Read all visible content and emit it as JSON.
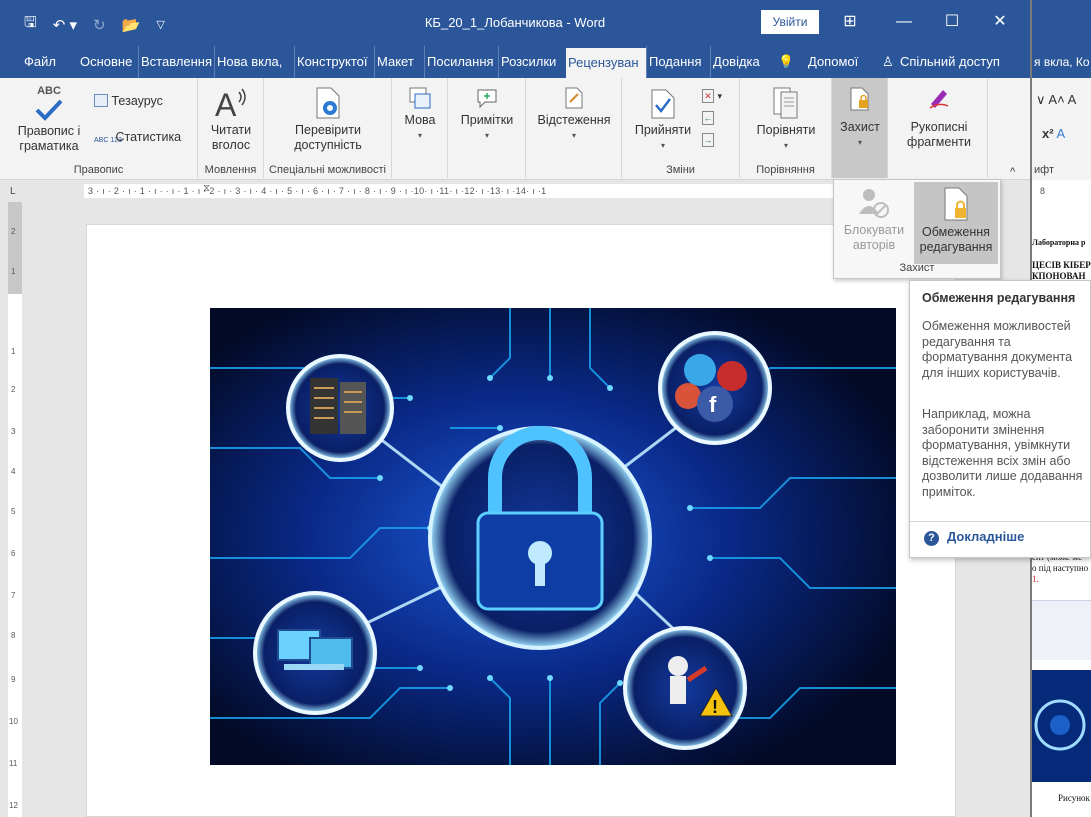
{
  "window": {
    "title": "КБ_20_1_Лобанчикова - Word",
    "login_label": "Увійти",
    "minimize": "—",
    "restore": "☐",
    "close": "✕"
  },
  "tabs": [
    {
      "label": "Файл"
    },
    {
      "label": "Основне"
    },
    {
      "label": "Вставлення"
    },
    {
      "label": "Нова вкла,"
    },
    {
      "label": "Конструктої"
    },
    {
      "label": "Макет"
    },
    {
      "label": "Посилання"
    },
    {
      "label": "Розсилки"
    },
    {
      "label": "Рецензуван"
    },
    {
      "label": "Подання"
    },
    {
      "label": "Довідка"
    },
    {
      "label": "Допомої"
    },
    {
      "label": "Спільний доступ"
    }
  ],
  "ribbon": {
    "proofing": {
      "spelling_top": "ABC",
      "spelling_line1": "Правопис і",
      "spelling_line2": "граматика",
      "thesaurus": "Тезаурус",
      "stats_icon_text": "ABC 123",
      "stats": "Статистика",
      "group": "Правопис"
    },
    "speech": {
      "line1": "Читати",
      "line2": "вголос",
      "group": "Мовлення"
    },
    "access": {
      "line1": "Перевірити",
      "line2": "доступність",
      "group": "Спеціальні можливості"
    },
    "language": {
      "label": "Мова"
    },
    "comments": {
      "label": "Примітки"
    },
    "tracking": {
      "label": "Відстеження"
    },
    "changes": {
      "accept": "Прийняти",
      "group": "Зміни"
    },
    "compare": {
      "label": "Порівняти",
      "group": "Порівняння"
    },
    "protect": {
      "label": "Захист"
    },
    "ink": {
      "line1": "Рукописні",
      "line2": "фрагменти"
    }
  },
  "ruler": {
    "text": "3 · ı · 2 · ı · 1 · ı ·  ·  ı · 1 · ı · 2 · ı · 3 · ı · 4 · ı · 5 · ı · 6 · ı · 7 · ı · 8 · ı · 9 · ı ·10· ı ·11· ı ·12· ı ·13· ı ·14· ı ·1"
  },
  "protect_dropdown": {
    "block_line1": "Блокувати",
    "block_line2": "авторів",
    "restrict_line1": "Обмеження",
    "restrict_line2": "редагування",
    "group": "Захист"
  },
  "tooltip": {
    "title": "Обмеження редагування",
    "p1": "Обмеження можливостей редагування та форматування документа для інших користувачів.",
    "p2": "Наприклад, можна заборонити змінення форматування, увімкнути відстеження всіх змін або дозволити лише додавання приміток.",
    "more": "Докладніше"
  },
  "right_window": {
    "tabs": "я вкла, Ко",
    "font_group": "ифт",
    "ruler_num": "8",
    "line1": "Лабораторна р",
    "line2": "ЦЕСІВ КІБЕР",
    "line3": "КПОНОВАН",
    "line4": "ент (може мс",
    "line5": "о під наступно",
    "line6": "1.",
    "caption": "Рисунок"
  },
  "colors": {
    "accent": "#2b579a",
    "ribbon": "#f3f3f3",
    "circuit": "#18b4ff"
  }
}
